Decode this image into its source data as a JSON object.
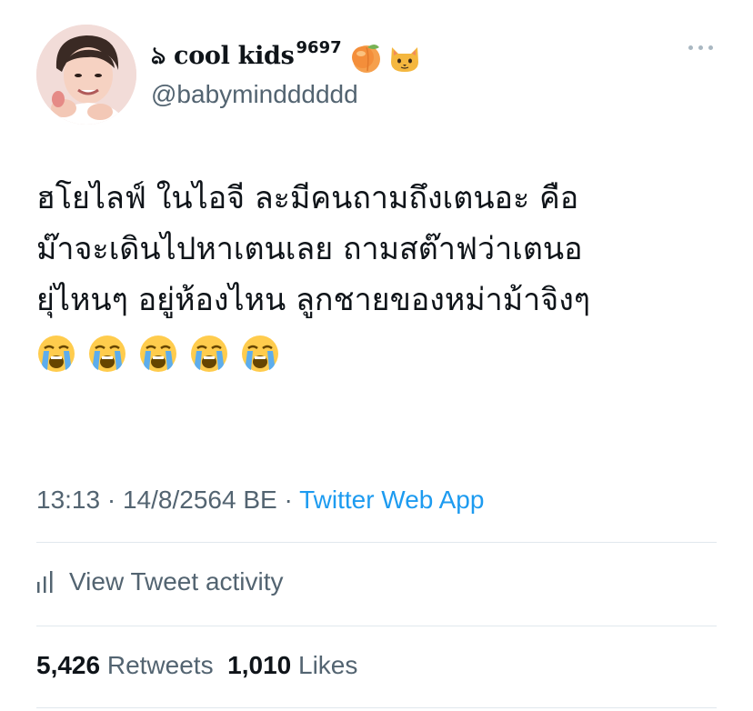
{
  "author": {
    "display_name": "ঌ cool kids",
    "name_suffix": "9697",
    "name_emojis": [
      "peach-emoji",
      "cat-face-emoji"
    ],
    "handle": "@babymindddddd"
  },
  "menu": {
    "icon": "more-horizontal-icon"
  },
  "tweet": {
    "lines": [
      "ฮโยไลฟ์ ในไอจี ละมีคนถามถึงเตนอะ คือ",
      "ม๊าจะเดินไปหาเตนเลย ถามสต๊าฟว่าเตนอ",
      "ยุ่ไหนๆ อยู่ห้องไหน ลูกชายของหม่าม้าจิงๆ"
    ],
    "emojis": [
      "loudly-crying-face-emoji",
      "loudly-crying-face-emoji",
      "loudly-crying-face-emoji",
      "loudly-crying-face-emoji",
      "loudly-crying-face-emoji"
    ]
  },
  "meta": {
    "time": "13:13",
    "sep1": " · ",
    "date": "14/8/2564 BE",
    "sep2": " · ",
    "source": "Twitter Web App"
  },
  "activity": {
    "icon": "bar-chart-icon",
    "label": "View Tweet activity"
  },
  "stats": {
    "retweets_count": "5,426",
    "retweets_label": "Retweets",
    "likes_count": "1,010",
    "likes_label": "Likes"
  },
  "colors": {
    "text": "#0f1419",
    "secondary": "#536471",
    "link": "#1d9bf0",
    "divider": "#e1e8ed"
  }
}
